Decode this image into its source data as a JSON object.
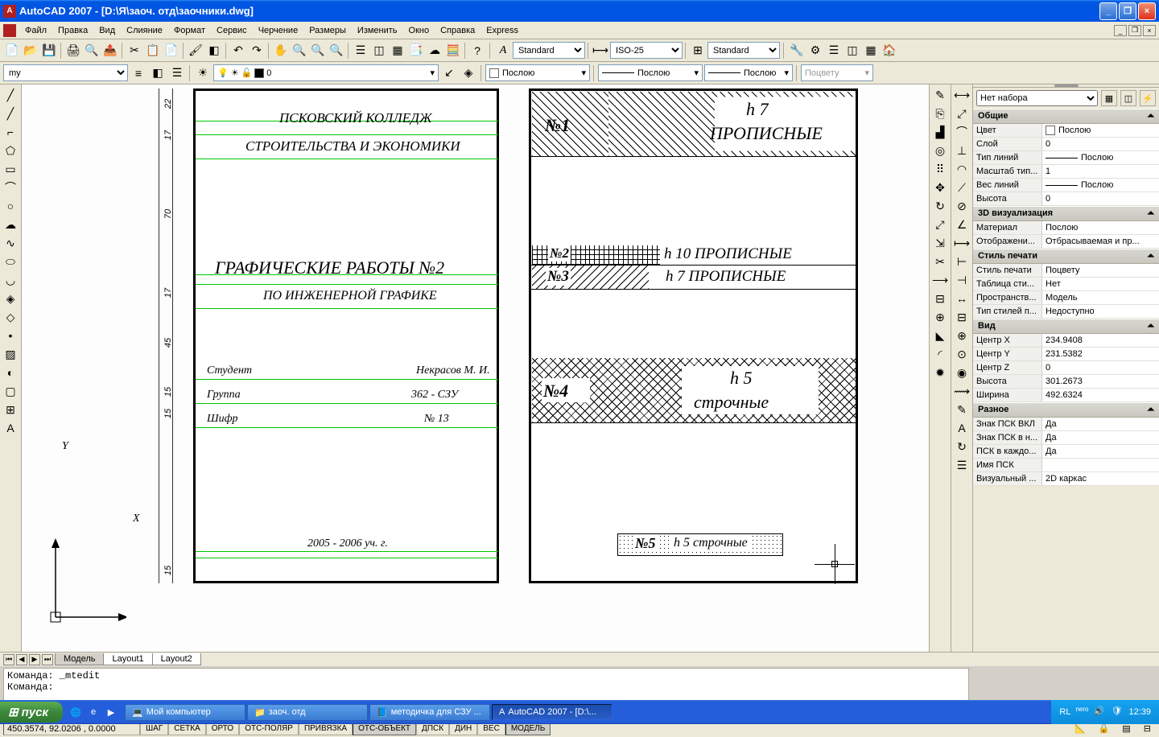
{
  "window": {
    "title": "AutoCAD 2007 - [D:\\Я\\заоч. отд\\заочники.dwg]"
  },
  "menu": {
    "items": [
      "Файл",
      "Правка",
      "Вид",
      "Слияние",
      "Формат",
      "Сервис",
      "Черчение",
      "Размеры",
      "Изменить",
      "Окно",
      "Справка",
      "Express"
    ]
  },
  "toolbars": {
    "style_standard": "Standard",
    "dim_iso": "ISO-25",
    "table_standard": "Standard",
    "layer_combo": "my",
    "layer_state": "0",
    "color_label": "Послою",
    "linetype_label": "Послою",
    "lineweight_label": "Послою",
    "plot_label": "Поцвету"
  },
  "tabs": {
    "model": "Модель",
    "layout1": "Layout1",
    "layout2": "Layout2"
  },
  "command": {
    "line1": "Команда: _mtedit",
    "line2": "Команда:"
  },
  "status": {
    "coords": "450.3574, 92.0206 , 0.0000",
    "toggles": [
      "ШАГ",
      "СЕТКА",
      "ОРТО",
      "ОТС-ПОЛЯР",
      "ПРИВЯЗКА",
      "ОТС-ОБЪЕКТ",
      "ДПСК",
      "ДИН",
      "ВЕС",
      "МОДЕЛЬ"
    ],
    "lang": "RL"
  },
  "drawing": {
    "left_frame": {
      "line1": "ПСКОВСКИЙ КОЛЛЕДЖ",
      "line2": "СТРОИТЕЛЬСТВА И ЭКОНОМИКИ",
      "title": "ГРАФИЧЕСКИЕ РАБОТЫ №2",
      "subtitle": "ПО ИНЖЕНЕРНОЙ ГРАФИКЕ",
      "student_label": "Студент",
      "student_name": "Некрасов М. И.",
      "group_label": "Группа",
      "group_name": "362 - СЗУ",
      "code_label": "Шифр",
      "code_value": "№ 13",
      "year": "2005 - 2006 уч. г.",
      "dims": {
        "d1": "22",
        "d2": "17",
        "d3": "70",
        "d4": "17",
        "d5": "45",
        "d6": "15",
        "d7": "15",
        "d8": "15"
      }
    },
    "right_frame": {
      "r1_num": "№1",
      "r1_text": "h 7\nПРОПИСНЫЕ",
      "r2_num": "№2",
      "r2_text": "h 10  ПРОПИСНЫЕ",
      "r3_num": "№3",
      "r3_text": "h 7  ПРОПИСНЫЕ",
      "r4_num": "№4",
      "r4_text": "h 5\nстрочные",
      "r5_num": "№5",
      "r5_text": "h 5  строчные"
    },
    "axes": {
      "x": "X",
      "y": "Y"
    }
  },
  "props": {
    "selector": "Нет набора",
    "sections": {
      "general": "Общие",
      "3d": "3D визуализация",
      "plot": "Стиль печати",
      "view": "Вид",
      "misc": "Разное"
    },
    "general": {
      "color_l": "Цвет",
      "color_v": "Послою",
      "layer_l": "Слой",
      "layer_v": "0",
      "ltype_l": "Тип линий",
      "ltype_v": "Послою",
      "ltscale_l": "Масштаб тип...",
      "ltscale_v": "1",
      "lweight_l": "Вес линий",
      "lweight_v": "Послою",
      "thick_l": "Высота",
      "thick_v": "0"
    },
    "3d": {
      "mat_l": "Материал",
      "mat_v": "Послою",
      "shadow_l": "Отображени...",
      "shadow_v": "Отбрасываемая и пр..."
    },
    "plot": {
      "pstyle_l": "Стиль печати",
      "pstyle_v": "Поцвету",
      "ptable_l": "Таблица сти...",
      "ptable_v": "Нет",
      "pspace_l": "Пространств...",
      "pspace_v": "Модель",
      "ptype_l": "Тип стилей п...",
      "ptype_v": "Недоступно"
    },
    "view": {
      "cx_l": "Центр X",
      "cx_v": "234.9408",
      "cy_l": "Центр Y",
      "cy_v": "231.5382",
      "cz_l": "Центр Z",
      "cz_v": "0",
      "h_l": "Высота",
      "h_v": "301.2673",
      "w_l": "Ширина",
      "w_v": "492.6324"
    },
    "misc": {
      "ucs1_l": "Знак ПСК ВКЛ",
      "ucs1_v": "Да",
      "ucs2_l": "Знак ПСК в н...",
      "ucs2_v": "Да",
      "ucs3_l": "ПСК в каждо...",
      "ucs3_v": "Да",
      "ucsname_l": "Имя ПСК",
      "ucsname_v": "",
      "vstyle_l": "Визуальный ...",
      "vstyle_v": "2D каркас"
    }
  },
  "taskbar": {
    "start": "пуск",
    "tasks": [
      {
        "label": "Мой компьютер"
      },
      {
        "label": "заоч. отд"
      },
      {
        "label": "методичка для СЗУ ..."
      },
      {
        "label": "AutoCAD 2007 - [D:\\..."
      }
    ],
    "clock": "12:39",
    "nero": "nero"
  }
}
